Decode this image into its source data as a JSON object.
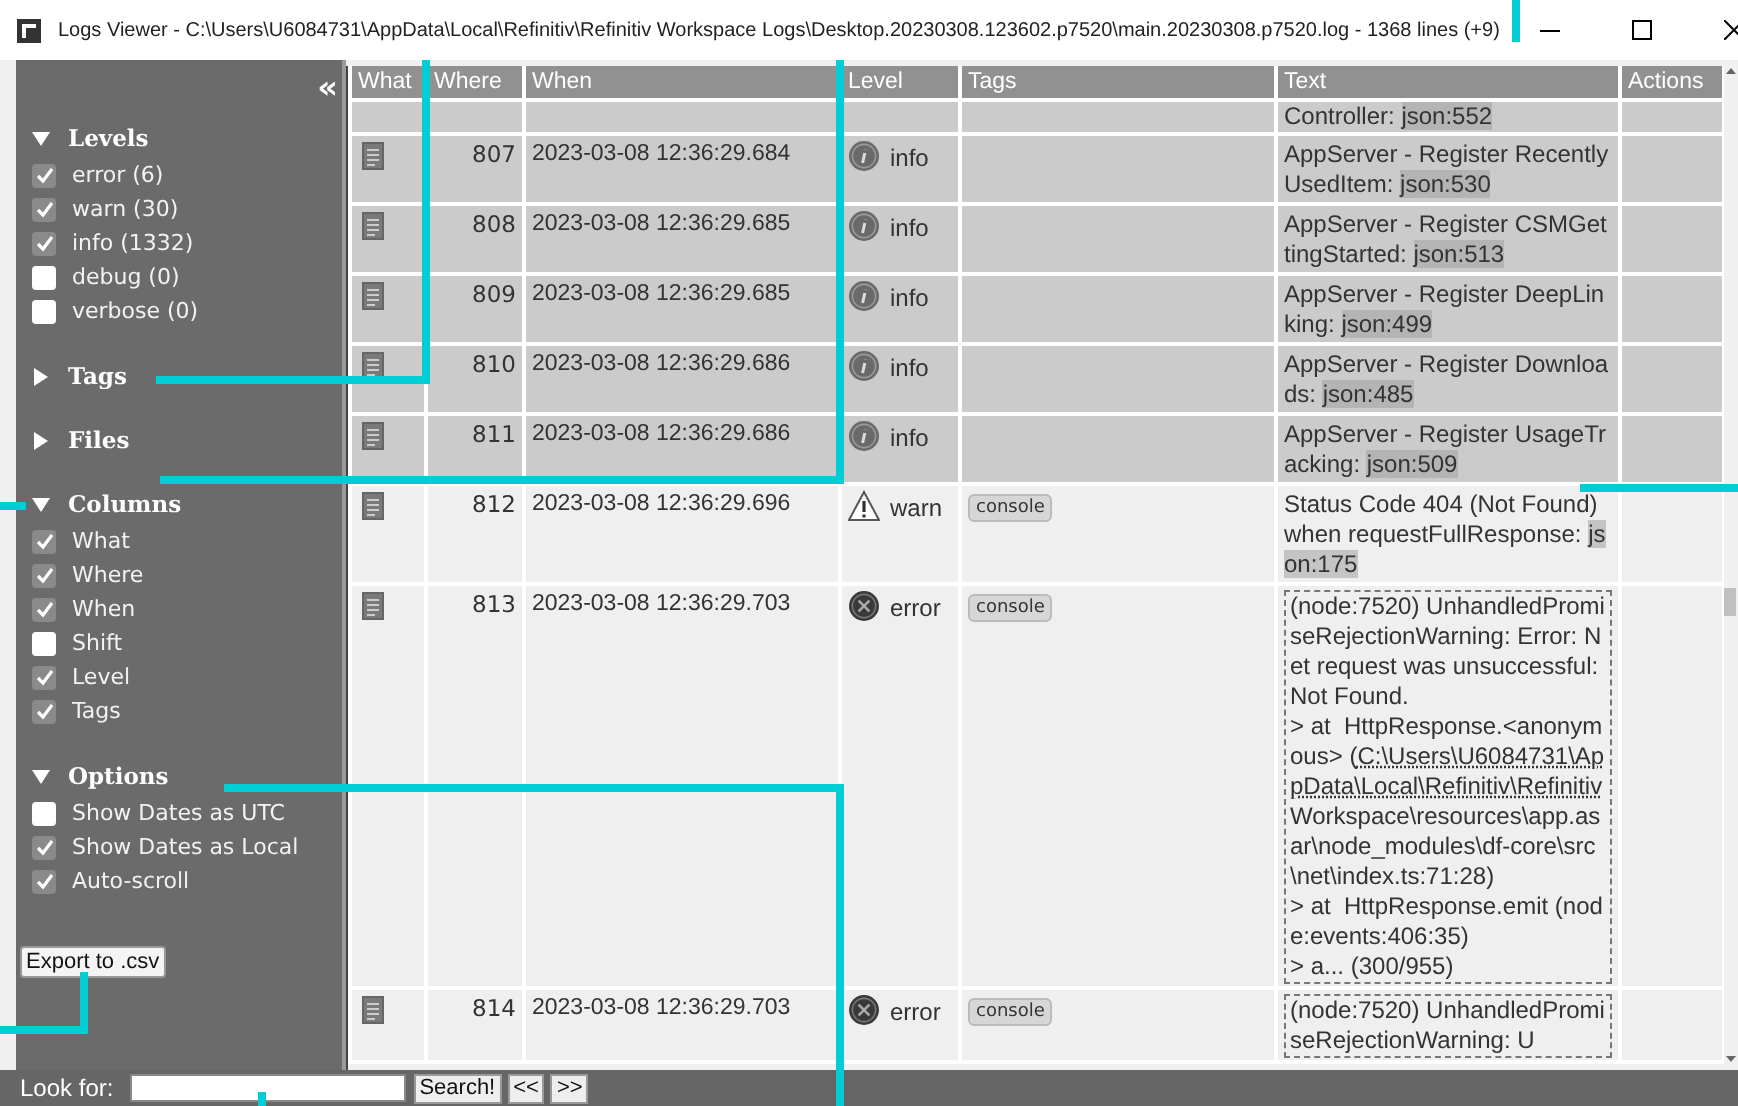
{
  "window": {
    "title": "Logs Viewer - C:\\Users\\U6084731\\AppData\\Local\\Refinitiv\\Refinitiv Workspace Logs\\Desktop.20230308.123602.p7520\\main.20230308.p7520.log - 1368 lines (+9)"
  },
  "sidebar": {
    "collapse_icon": "«",
    "sections": [
      {
        "title": "Levels",
        "expanded": true,
        "items": [
          {
            "label": "error (6)",
            "checked": true
          },
          {
            "label": "warn (30)",
            "checked": true
          },
          {
            "label": "info (1332)",
            "checked": true
          },
          {
            "label": "debug (0)",
            "checked": false
          },
          {
            "label": "verbose (0)",
            "checked": false
          }
        ]
      },
      {
        "title": "Tags",
        "expanded": false
      },
      {
        "title": "Files",
        "expanded": false
      },
      {
        "title": "Columns",
        "expanded": true,
        "items": [
          {
            "label": "What",
            "checked": true
          },
          {
            "label": "Where",
            "checked": true
          },
          {
            "label": "When",
            "checked": true
          },
          {
            "label": "Shift",
            "checked": false
          },
          {
            "label": "Level",
            "checked": true
          },
          {
            "label": "Tags",
            "checked": true
          }
        ]
      },
      {
        "title": "Options",
        "expanded": true,
        "items": [
          {
            "label": "Show Dates as UTC",
            "checked": false
          },
          {
            "label": "Show Dates as Local",
            "checked": true
          },
          {
            "label": "Auto-scroll",
            "checked": true
          }
        ]
      }
    ],
    "export_button": "Export to .csv"
  },
  "table": {
    "columns": [
      "What",
      "Where",
      "When",
      "Level",
      "Tags",
      "Text",
      "Actions"
    ],
    "rows": [
      {
        "highlighted": true,
        "partial": true,
        "text": [
          {
            "kind": "plain",
            "s": "Controller: "
          },
          {
            "kind": "ref",
            "s": "json:552"
          }
        ]
      },
      {
        "highlighted": true,
        "where": "807",
        "when": "2023-03-08 12:36:29.684",
        "kind": "info",
        "level_text": "info",
        "text": [
          {
            "kind": "plain",
            "s": "AppServer - Register RecentlyUsedItem: "
          },
          {
            "kind": "ref",
            "s": "json:530"
          }
        ]
      },
      {
        "highlighted": true,
        "where": "808",
        "when": "2023-03-08 12:36:29.685",
        "kind": "info",
        "level_text": "info",
        "text": [
          {
            "kind": "plain",
            "s": "AppServer - Register CSMGettingStarted: "
          },
          {
            "kind": "ref",
            "s": "json:513"
          }
        ]
      },
      {
        "highlighted": true,
        "where": "809",
        "when": "2023-03-08 12:36:29.685",
        "kind": "info",
        "level_text": "info",
        "text": [
          {
            "kind": "plain",
            "s": "AppServer - Register DeepLinking: "
          },
          {
            "kind": "ref",
            "s": "json:499"
          }
        ]
      },
      {
        "highlighted": true,
        "where": "810",
        "when": "2023-03-08 12:36:29.686",
        "kind": "info",
        "level_text": "info",
        "text": [
          {
            "kind": "plain",
            "s": "AppServer - Register Downloads: "
          },
          {
            "kind": "ref",
            "s": "json:485"
          }
        ]
      },
      {
        "highlighted": true,
        "where": "811",
        "when": "2023-03-08 12:36:29.686",
        "kind": "info",
        "level_text": "info",
        "text": [
          {
            "kind": "plain",
            "s": "AppServer - Register UsageTracking: "
          },
          {
            "kind": "ref",
            "s": "json:509"
          }
        ]
      },
      {
        "highlighted": false,
        "where": "812",
        "when": "2023-03-08 12:36:29.696",
        "kind": "warn",
        "level_text": "warn",
        "tags": [
          "console"
        ],
        "text": [
          {
            "kind": "plain",
            "s": "Status Code 404 (Not Found) when requestFullResponse: "
          },
          {
            "kind": "ref",
            "s": "json:175"
          }
        ]
      },
      {
        "highlighted": false,
        "boxed": true,
        "where": "813",
        "when": "2023-03-08 12:36:29.703",
        "kind": "error",
        "level_text": "error",
        "tags": [
          "console"
        ],
        "text": [
          {
            "kind": "plain",
            "s": "(node:7520) UnhandledPromiseRejectionWarning: Error: Net request was unsuccessful: Not Found.\n> at  HttpResponse.<anonymous> ("
          },
          {
            "kind": "path",
            "s": "C:\\Users\\U6084731\\AppData\\Local\\Refinitiv\\Refinitiv"
          },
          {
            "kind": "plain",
            "s": " Workspace\\resources\\app.asar\\node_modules\\df-core\\src\\net\\index.ts:71:28)\n> at  HttpResponse.emit (node:events:406:35)\n> a... (300/955)"
          }
        ]
      },
      {
        "highlighted": false,
        "boxed": true,
        "where": "814",
        "when": "2023-03-08 12:36:29.703",
        "kind": "error",
        "level_text": "error",
        "tags": [
          "console"
        ],
        "text": [
          {
            "kind": "plain",
            "s": "(node:7520) UnhandledPromiseRejectionWarning: U"
          }
        ]
      }
    ]
  },
  "search_bar": {
    "label": "Look for:",
    "buttons": [
      "Search!",
      "<<",
      ">>"
    ]
  }
}
